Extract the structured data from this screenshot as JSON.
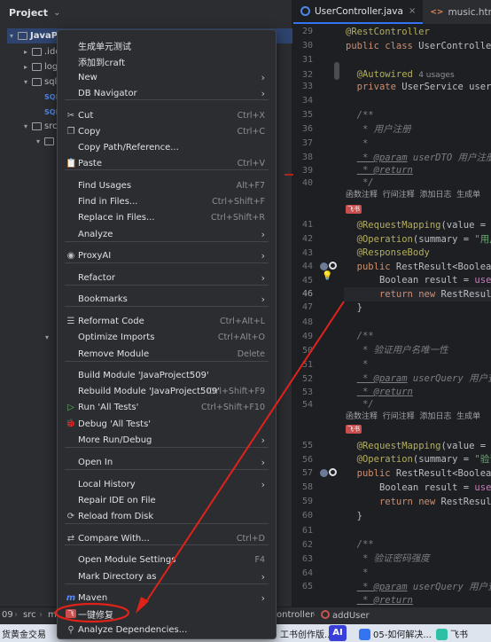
{
  "project_panel": {
    "title": "Project",
    "rows": [
      {
        "label": "JavaP",
        "kind": "folder"
      },
      {
        "label": ".ide",
        "kind": "folder"
      },
      {
        "label": "log",
        "kind": "folder"
      },
      {
        "label": "sql",
        "kind": "folder"
      },
      {
        "label": "SQL",
        "kind": "file"
      },
      {
        "label": "SQL",
        "kind": "file"
      },
      {
        "label": "src",
        "kind": "folder"
      },
      {
        "label": "",
        "kind": "folder"
      }
    ]
  },
  "editor": {
    "tabs": [
      {
        "label": "UserController.java",
        "icon": "java-class-icon",
        "active": true
      },
      {
        "label": "music.html",
        "icon": "html-icon",
        "active": false
      }
    ],
    "line_numbers": [
      "29",
      "30",
      "31",
      "32",
      "33",
      "34",
      "35",
      "36",
      "37",
      "38",
      "39",
      "40",
      "",
      "41",
      "42",
      "43",
      "44",
      "45",
      "46",
      "47",
      "48",
      "49",
      "50",
      "51",
      "52",
      "53",
      "54",
      "",
      "55",
      "56",
      "57",
      "58",
      "59",
      "60",
      "61",
      "62",
      "63",
      "64",
      "65"
    ],
    "code": {
      "l29": "@RestController",
      "l30_kw": "public class",
      "l30_name": " UserController {",
      "l32": "@Autowired",
      "l32_usages": "4 usages",
      "l33_kw": "private",
      "l33_rest": " UserService userS",
      "l35": "/**",
      "l36": " * 用户注册",
      "l37": " *",
      "l38_a": " * @param",
      "l38_b": " userDTO 用户注册信",
      "l39": " * @return",
      "l40": " */",
      "hint1": "函数注释  行间注释  添加日志  生成单",
      "hint_badge": "飞书",
      "l41_a": "@RequestMapping",
      "l41_b": "(value = \"/",
      "l42_a": "@Operation",
      "l42_b": "(summary = ",
      "l42_c": "\"用户",
      "l43": "@ResponseBody",
      "l44_kw": "public",
      "l44_rest": " RestResult<Boolean",
      "l45_a": "    Boolean result = ",
      "l45_b": "user",
      "l46_kw": "    return new",
      "l46_rest": " RestResult",
      "l47": "}",
      "l49": "/**",
      "l50": " * 验证用户名唯一性",
      "l51": " *",
      "l52_a": " * @param",
      "l52_b": " userQuery 用户查",
      "l53": " * @return",
      "l54": " */",
      "hint2": "函数注释  行间注释  添加日志  生成单",
      "l55_a": "@RequestMapping",
      "l55_b": "(value = \"",
      "l56_a": "@Operation",
      "l56_b": "(summary = ",
      "l56_c": "\"验证",
      "l57_kw": "public",
      "l57_rest": " RestResult<Boolean",
      "l58_a": "    Boolean result = ",
      "l58_b": "user",
      "l59_kw": "    return new",
      "l59_rest": " RestResult",
      "l60": "}",
      "l62": "/**",
      "l63": " * 验证密码强度",
      "l64": " *",
      "l65_a": " * @param",
      "l65_b": " userQuery 用户查",
      "l66": " * @return"
    }
  },
  "breadcrumb": {
    "left_a": "09",
    "left_b": "src",
    "left_c": "m",
    "right_a": "ontroller",
    "right_b": "addUser"
  },
  "context_menu": {
    "items": [
      {
        "label": "生成单元测试",
        "shortcut": "",
        "arrow": false,
        "icon": ""
      },
      {
        "label": "添加到craft",
        "shortcut": "",
        "arrow": false,
        "icon": ""
      },
      {
        "label": "New",
        "shortcut": "",
        "arrow": true,
        "icon": ""
      },
      {
        "label": "DB Navigator",
        "shortcut": "",
        "arrow": true,
        "icon": ""
      },
      {
        "label": "Cut",
        "shortcut": "Ctrl+X",
        "arrow": false,
        "icon": "scissors-icon"
      },
      {
        "label": "Copy",
        "shortcut": "Ctrl+C",
        "arrow": false,
        "icon": "copy-icon"
      },
      {
        "label": "Copy Path/Reference...",
        "shortcut": "",
        "arrow": false,
        "icon": ""
      },
      {
        "label": "Paste",
        "shortcut": "Ctrl+V",
        "arrow": false,
        "icon": "paste-icon"
      },
      {
        "label": "Find Usages",
        "shortcut": "Alt+F7",
        "arrow": false,
        "icon": ""
      },
      {
        "label": "Find in Files...",
        "shortcut": "Ctrl+Shift+F",
        "arrow": false,
        "icon": ""
      },
      {
        "label": "Replace in Files...",
        "shortcut": "Ctrl+Shift+R",
        "arrow": false,
        "icon": ""
      },
      {
        "label": "Analyze",
        "shortcut": "",
        "arrow": true,
        "icon": ""
      },
      {
        "label": "ProxyAI",
        "shortcut": "",
        "arrow": true,
        "icon": "proxyai-icon"
      },
      {
        "label": "Refactor",
        "shortcut": "",
        "arrow": true,
        "icon": ""
      },
      {
        "label": "Bookmarks",
        "shortcut": "",
        "arrow": true,
        "icon": ""
      },
      {
        "label": "Reformat Code",
        "shortcut": "Ctrl+Alt+L",
        "arrow": false,
        "icon": "reformat-icon"
      },
      {
        "label": "Optimize Imports",
        "shortcut": "Ctrl+Alt+O",
        "arrow": false,
        "icon": ""
      },
      {
        "label": "Remove Module",
        "shortcut": "Delete",
        "arrow": false,
        "icon": ""
      },
      {
        "label": "Build Module 'JavaProject509'",
        "shortcut": "",
        "arrow": false,
        "icon": ""
      },
      {
        "label": "Rebuild Module 'JavaProject509'",
        "shortcut": "Ctrl+Shift+F9",
        "arrow": false,
        "icon": ""
      },
      {
        "label": "Run 'All Tests'",
        "shortcut": "Ctrl+Shift+F10",
        "arrow": false,
        "icon": "run-icon"
      },
      {
        "label": "Debug 'All Tests'",
        "shortcut": "",
        "arrow": false,
        "icon": "debug-icon"
      },
      {
        "label": "More Run/Debug",
        "shortcut": "",
        "arrow": true,
        "icon": ""
      },
      {
        "label": "Open In",
        "shortcut": "",
        "arrow": true,
        "icon": ""
      },
      {
        "label": "Local History",
        "shortcut": "",
        "arrow": true,
        "icon": ""
      },
      {
        "label": "Repair IDE on File",
        "shortcut": "",
        "arrow": false,
        "icon": ""
      },
      {
        "label": "Reload from Disk",
        "shortcut": "",
        "arrow": false,
        "icon": "reload-icon"
      },
      {
        "label": "Compare With...",
        "shortcut": "Ctrl+D",
        "arrow": false,
        "icon": "compare-icon"
      },
      {
        "label": "Open Module Settings",
        "shortcut": "F4",
        "arrow": false,
        "icon": ""
      },
      {
        "label": "Mark Directory as",
        "shortcut": "",
        "arrow": true,
        "icon": ""
      },
      {
        "label": "Maven",
        "shortcut": "",
        "arrow": true,
        "icon": "maven-icon"
      },
      {
        "label": "一键修复",
        "shortcut": "",
        "arrow": false,
        "icon": "feishu-badge-icon"
      },
      {
        "label": "Analyze Dependencies...",
        "shortcut": "",
        "arrow": false,
        "icon": "search-icon"
      }
    ]
  },
  "taskbar": {
    "left": "货黄金交易",
    "mid": "工书创作版...",
    "ai": "AI",
    "task": "05-如何解决...",
    "app": "飞书"
  },
  "colors": {
    "accent": "#3574f0",
    "annotation_circle": "#e0231a"
  }
}
